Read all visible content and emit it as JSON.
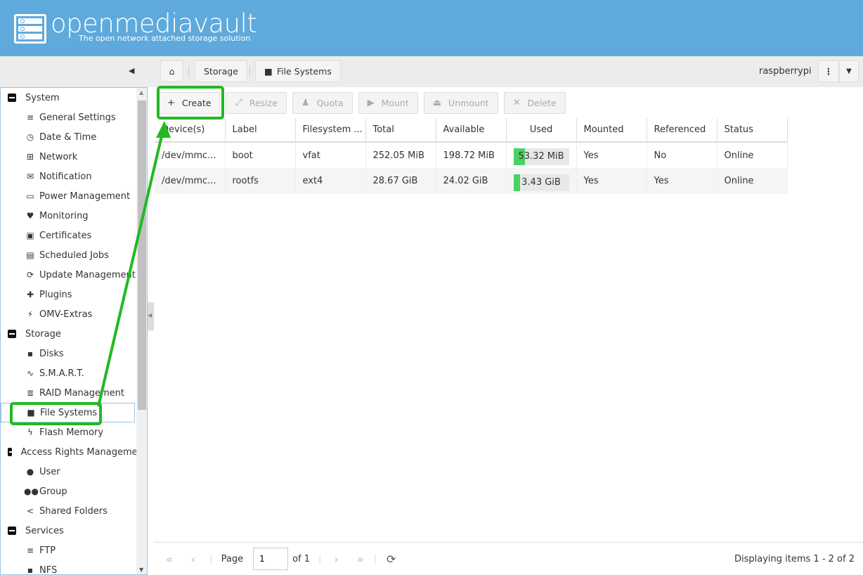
{
  "header": {
    "title": "openmediavault",
    "subtitle": "The open network attached storage solution"
  },
  "breadcrumb": {
    "items": [
      "Storage",
      "File Systems"
    ],
    "host": "raspberrypi"
  },
  "sidebar": {
    "groups": [
      {
        "label": "System",
        "items": [
          {
            "label": "General Settings",
            "icon": "≡"
          },
          {
            "label": "Date & Time",
            "icon": "◷"
          },
          {
            "label": "Network",
            "icon": "⊞"
          },
          {
            "label": "Notification",
            "icon": "✉"
          },
          {
            "label": "Power Management",
            "icon": "▭"
          },
          {
            "label": "Monitoring",
            "icon": "♥"
          },
          {
            "label": "Certificates",
            "icon": "▣"
          },
          {
            "label": "Scheduled Jobs",
            "icon": "▤"
          },
          {
            "label": "Update Management",
            "icon": "⟳"
          },
          {
            "label": "Plugins",
            "icon": "✚"
          },
          {
            "label": "OMV-Extras",
            "icon": "⚡"
          }
        ]
      },
      {
        "label": "Storage",
        "items": [
          {
            "label": "Disks",
            "icon": "▪"
          },
          {
            "label": "S.M.A.R.T.",
            "icon": "∿"
          },
          {
            "label": "RAID Management",
            "icon": "≣"
          },
          {
            "label": "File Systems",
            "icon": "■",
            "selected": true
          },
          {
            "label": "Flash Memory",
            "icon": "ϟ"
          }
        ]
      },
      {
        "label": "Access Rights Management",
        "items": [
          {
            "label": "User",
            "icon": "●"
          },
          {
            "label": "Group",
            "icon": "●●"
          },
          {
            "label": "Shared Folders",
            "icon": "<"
          }
        ]
      },
      {
        "label": "Services",
        "items": [
          {
            "label": "FTP",
            "icon": "≡"
          },
          {
            "label": "NFS",
            "icon": "▪"
          }
        ]
      }
    ]
  },
  "toolbar": {
    "buttons": [
      {
        "label": "Create",
        "icon": "+",
        "enabled": true
      },
      {
        "label": "Resize",
        "icon": "⤢"
      },
      {
        "label": "Quota",
        "icon": "♟"
      },
      {
        "label": "Mount",
        "icon": "▶"
      },
      {
        "label": "Unmount",
        "icon": "⏏"
      },
      {
        "label": "Delete",
        "icon": "✕"
      }
    ]
  },
  "table": {
    "columns": [
      "Device(s)",
      "Label",
      "Filesystem ...",
      "Total",
      "Available",
      "Used",
      "Mounted",
      "Referenced",
      "Status"
    ],
    "rows": [
      {
        "device": "/dev/mmc...",
        "label": "boot",
        "fs": "vfat",
        "total": "252.05 MiB",
        "available": "198.72 MiB",
        "used": "53.32 MiB",
        "used_pct": 21,
        "mounted": "Yes",
        "referenced": "No",
        "status": "Online"
      },
      {
        "device": "/dev/mmc...",
        "label": "rootfs",
        "fs": "ext4",
        "total": "28.67 GiB",
        "available": "24.02 GiB",
        "used": "3.43 GiB",
        "used_pct": 12,
        "mounted": "Yes",
        "referenced": "Yes",
        "status": "Online"
      }
    ]
  },
  "pager": {
    "page_label": "Page",
    "page": "1",
    "of": "of 1",
    "display": "Displaying items 1 - 2 of 2"
  },
  "colors": {
    "header": "#5eaadc",
    "annotation": "#22b922",
    "used_bar": "#4cd164"
  }
}
